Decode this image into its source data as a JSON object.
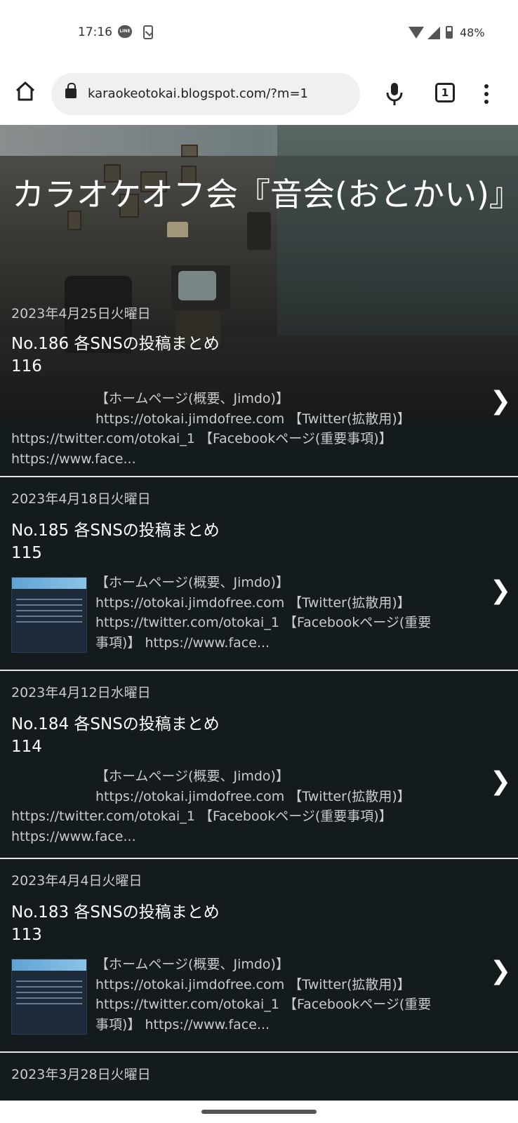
{
  "status_bar": {
    "time": "17:16",
    "line_icon_text": "LINE",
    "battery": "48%"
  },
  "browser": {
    "url": "karaokeotokai.blogspot.com/?m=1",
    "tab_count": "1"
  },
  "blog": {
    "title": "カラオケオフ会『音会(おとかい)』"
  },
  "posts": [
    {
      "date": "2023年4月25日火曜日",
      "title_line1": "No.186 各SNSの投稿まとめ",
      "title_line2": "116",
      "snippet_lines": [
        "【ホームページ(概要、Jimdo)】",
        "https://otokai.jimdofree.com 【Twitter(拡散用)】",
        "https://twitter.com/otokai_1 【Facebookページ(重要事項)】",
        "https://www.face..."
      ],
      "has_thumbnail": false
    },
    {
      "date": "2023年4月18日火曜日",
      "title_line1": "No.185 各SNSの投稿まとめ",
      "title_line2": "115",
      "snippet_lines": [
        "【ホームページ(概要、Jimdo)】",
        "https://otokai.jimdofree.com 【Twitter(拡散用)】",
        "https://twitter.com/otokai_1 【Facebookページ(重要",
        "事項)】 https://www.face..."
      ],
      "has_thumbnail": true
    },
    {
      "date": "2023年4月12日水曜日",
      "title_line1": "No.184 各SNSの投稿まとめ",
      "title_line2": "114",
      "snippet_lines": [
        "【ホームページ(概要、Jimdo)】",
        "https://otokai.jimdofree.com 【Twitter(拡散用)】",
        "https://twitter.com/otokai_1 【Facebookページ(重要事項)】",
        "https://www.face..."
      ],
      "has_thumbnail": false
    },
    {
      "date": "2023年4月4日火曜日",
      "title_line1": "No.183 各SNSの投稿まとめ",
      "title_line2": "113",
      "snippet_lines": [
        "【ホームページ(概要、Jimdo)】",
        "https://otokai.jimdofree.com 【Twitter(拡散用)】",
        "https://twitter.com/otokai_1 【Facebookページ(重要",
        "事項)】 https://www.face..."
      ],
      "has_thumbnail": true
    },
    {
      "date": "2023年3月28日火曜日"
    }
  ],
  "icons": {
    "chevron": "❯"
  }
}
